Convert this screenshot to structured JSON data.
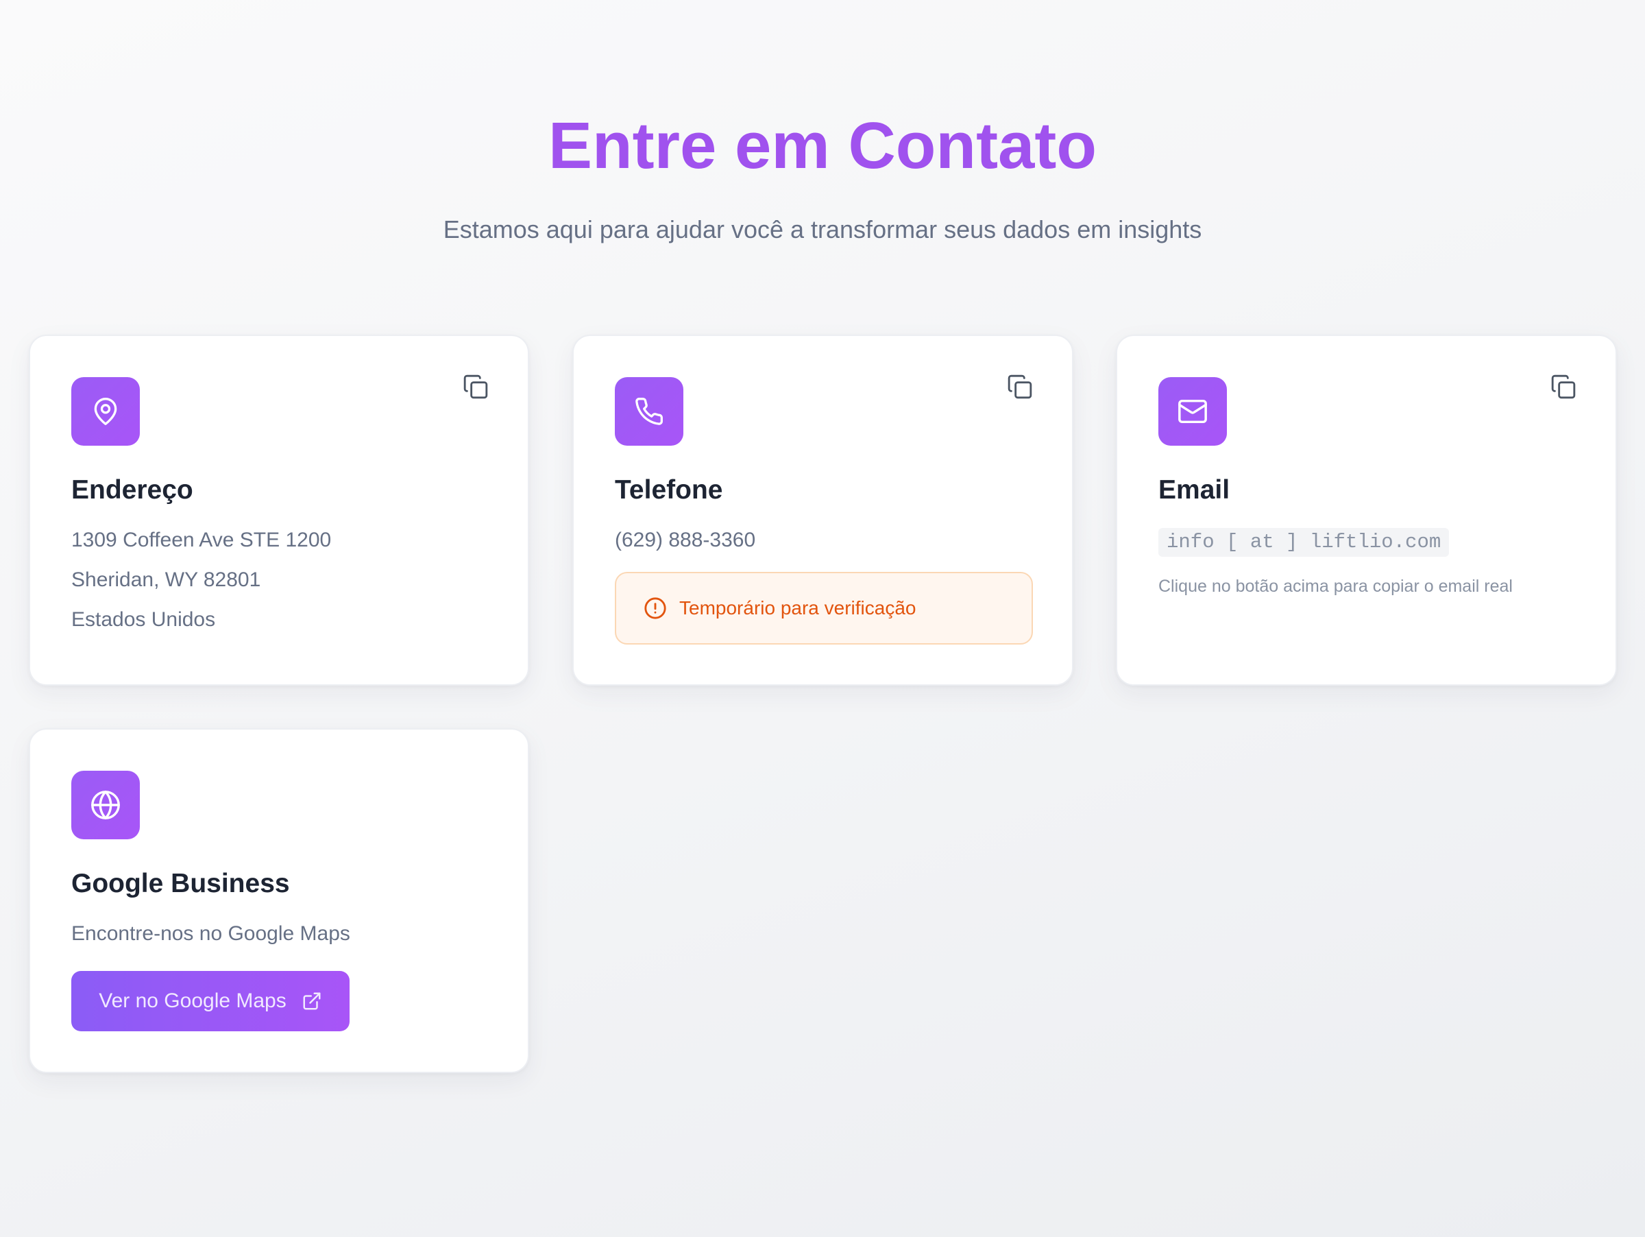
{
  "header": {
    "title": "Entre em Contato",
    "subtitle": "Estamos aqui para ajudar você a transformar seus dados em insights"
  },
  "cards": {
    "address": {
      "icon": "map-pin-icon",
      "title": "Endereço",
      "lines": [
        "1309 Coffeen Ave STE 1200",
        "Sheridan, WY 82801",
        "Estados Unidos"
      ],
      "copy_icon": "copy-icon"
    },
    "phone": {
      "icon": "phone-icon",
      "title": "Telefone",
      "number": "(629) 888-3360",
      "warning": "Temporário para verificação",
      "warning_icon": "alert-circle-icon",
      "copy_icon": "copy-icon"
    },
    "email": {
      "icon": "mail-icon",
      "title": "Email",
      "obfuscated": "info [ at ] liftlio.com",
      "hint": "Clique no botão acima para copiar o email real",
      "copy_icon": "copy-icon"
    },
    "google": {
      "icon": "globe-icon",
      "title": "Google Business",
      "text": "Encontre-nos no Google Maps",
      "button_label": "Ver no Google Maps",
      "button_icon": "external-link-icon"
    }
  },
  "colors": {
    "accent": "#a052ee",
    "icon_bg": "#9b5cf6",
    "warning_text": "#e2540e",
    "warning_bg": "#fff6ef",
    "warning_border": "#fbd7b4"
  }
}
